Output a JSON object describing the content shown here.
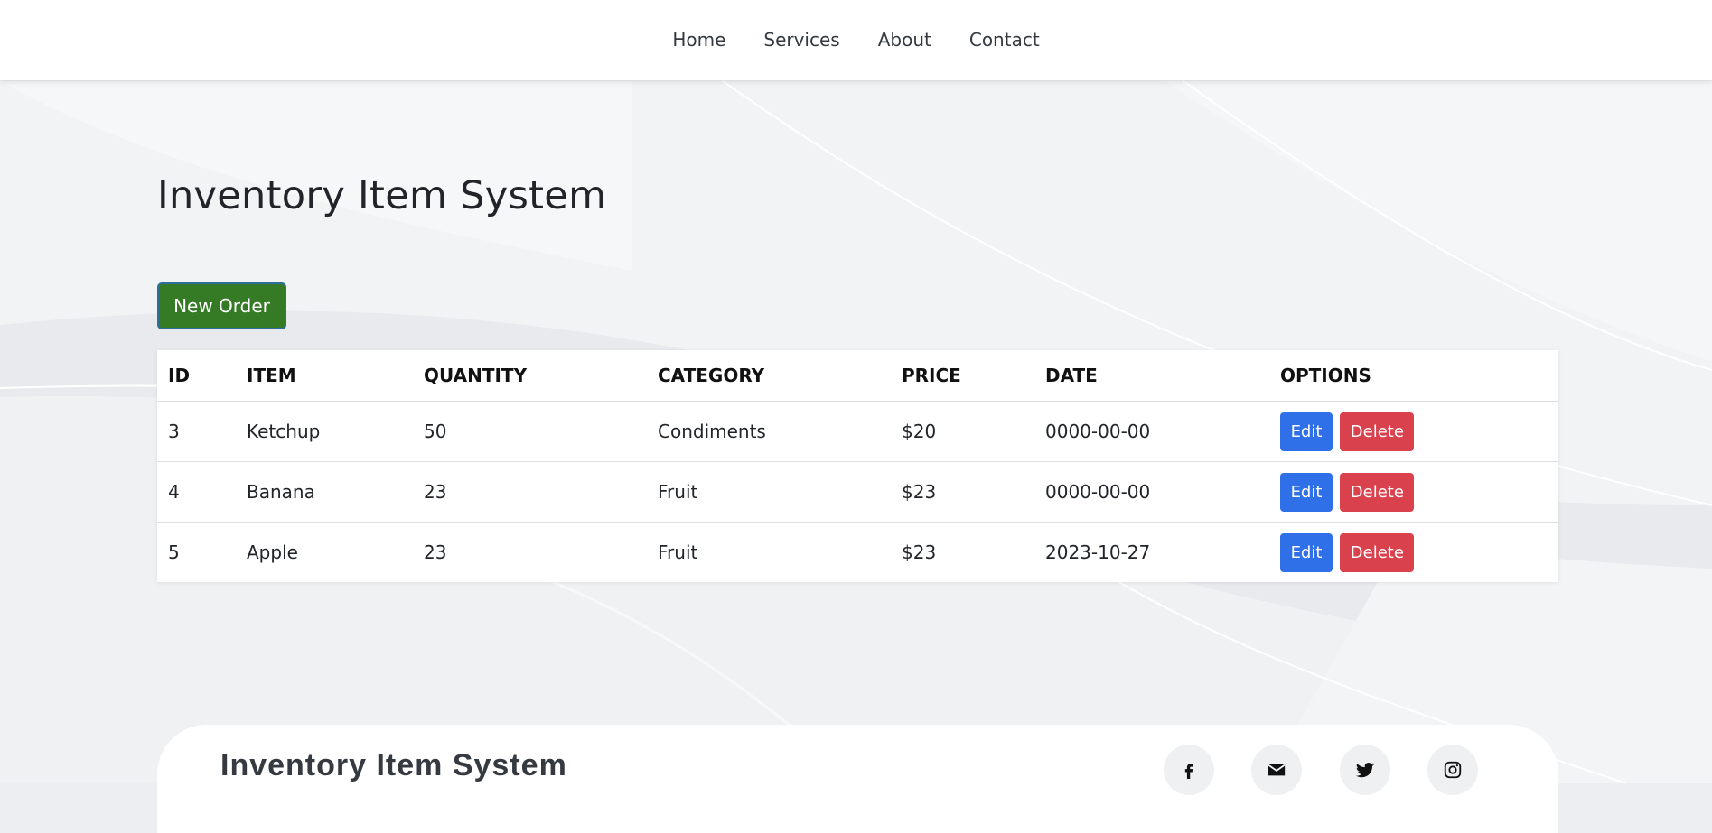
{
  "nav": {
    "items": [
      {
        "label": "Home"
      },
      {
        "label": "Services"
      },
      {
        "label": "About"
      },
      {
        "label": "Contact"
      }
    ]
  },
  "page": {
    "title": "Inventory Item System",
    "new_order_label": "New Order"
  },
  "table": {
    "headers": [
      "ID",
      "ITEM",
      "QUANTITY",
      "CATEGORY",
      "PRICE",
      "DATE",
      "OPTIONS"
    ],
    "rows": [
      {
        "id": "3",
        "item": "Ketchup",
        "quantity": "50",
        "category": "Condiments",
        "price": "$20",
        "date": "0000-00-00"
      },
      {
        "id": "4",
        "item": "Banana",
        "quantity": "23",
        "category": "Fruit",
        "price": "$23",
        "date": "0000-00-00"
      },
      {
        "id": "5",
        "item": "Apple",
        "quantity": "23",
        "category": "Fruit",
        "price": "$23",
        "date": "2023-10-27"
      }
    ],
    "edit_label": "Edit",
    "delete_label": "Delete"
  },
  "footer": {
    "title": "Inventory Item System",
    "social": [
      "facebook-icon",
      "envelope-icon",
      "twitter-icon",
      "instagram-icon"
    ]
  },
  "colors": {
    "new_order": "#357a25",
    "edit": "#2f6fe8",
    "delete": "#d9414d"
  }
}
